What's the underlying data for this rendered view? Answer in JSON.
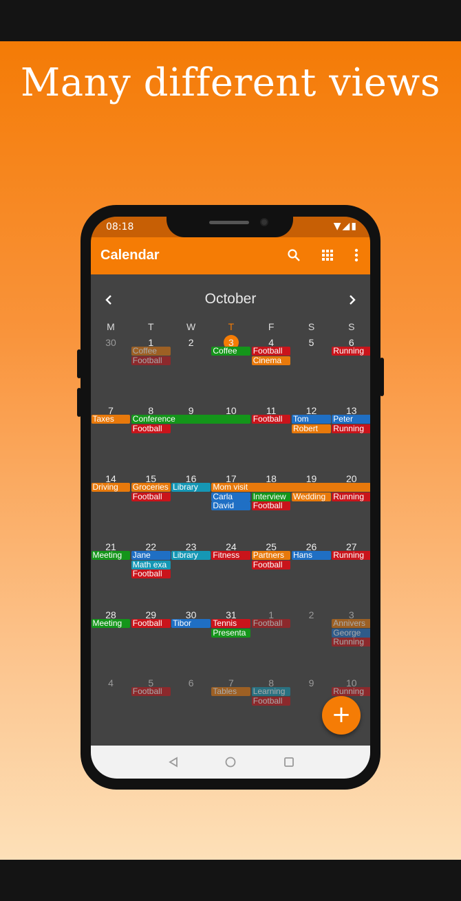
{
  "headline": "Many different views",
  "status": {
    "time": "08:18",
    "icons": [
      "wifi-icon",
      "signal-icon",
      "battery-icon"
    ]
  },
  "toolbar": {
    "title": "Calendar",
    "icons": [
      "search-icon",
      "grid-icon",
      "more-vert-icon"
    ]
  },
  "month": "October",
  "weekdays": [
    "M",
    "T",
    "W",
    "T",
    "F",
    "S",
    "S"
  ],
  "today_col": 3,
  "colors": {
    "accent": "#f57c05",
    "orange": "#e8790b",
    "red": "#c9141b",
    "green": "#14951a",
    "blue": "#1f6fc4",
    "teal": "#1597b5",
    "brown": "#b7671c"
  },
  "weeks": [
    {
      "days": [
        {
          "n": "30",
          "dim": true
        },
        {
          "n": "1"
        },
        {
          "n": "2"
        },
        {
          "n": "3",
          "today": true
        },
        {
          "n": "4"
        },
        {
          "n": "5"
        },
        {
          "n": "6"
        }
      ],
      "events": [
        {
          "t": "Coffee",
          "c": 1,
          "s": 1,
          "r": 0,
          "col": "orange",
          "faded": true
        },
        {
          "t": "Football",
          "c": 1,
          "s": 1,
          "r": 1,
          "col": "red",
          "faded": true
        },
        {
          "t": "Coffee",
          "c": 3,
          "s": 1,
          "r": 0,
          "col": "green"
        },
        {
          "t": "Football",
          "c": 4,
          "s": 1,
          "r": 0,
          "col": "red"
        },
        {
          "t": "Cinema",
          "c": 4,
          "s": 1,
          "r": 1,
          "col": "orange"
        },
        {
          "t": "Running",
          "c": 6,
          "s": 1,
          "r": 0,
          "col": "red"
        }
      ]
    },
    {
      "days": [
        {
          "n": "7"
        },
        {
          "n": "8"
        },
        {
          "n": "9"
        },
        {
          "n": "10"
        },
        {
          "n": "11"
        },
        {
          "n": "12"
        },
        {
          "n": "13"
        }
      ],
      "events": [
        {
          "t": "Taxes",
          "c": 0,
          "s": 1,
          "r": 0,
          "col": "orange"
        },
        {
          "t": "Conference",
          "c": 1,
          "s": 3,
          "r": 0,
          "col": "green"
        },
        {
          "t": "Football",
          "c": 1,
          "s": 1,
          "r": 1,
          "col": "red"
        },
        {
          "t": "Football",
          "c": 4,
          "s": 1,
          "r": 0,
          "col": "red"
        },
        {
          "t": "Tom",
          "c": 5,
          "s": 1,
          "r": 0,
          "col": "blue"
        },
        {
          "t": "Robert",
          "c": 5,
          "s": 1,
          "r": 1,
          "col": "orange"
        },
        {
          "t": "Peter",
          "c": 6,
          "s": 1,
          "r": 0,
          "col": "blue"
        },
        {
          "t": "Running",
          "c": 6,
          "s": 1,
          "r": 1,
          "col": "red"
        }
      ]
    },
    {
      "days": [
        {
          "n": "14"
        },
        {
          "n": "15"
        },
        {
          "n": "16"
        },
        {
          "n": "17"
        },
        {
          "n": "18"
        },
        {
          "n": "19"
        },
        {
          "n": "20"
        }
      ],
      "events": [
        {
          "t": "Driving",
          "c": 0,
          "s": 1,
          "r": 0,
          "col": "orange"
        },
        {
          "t": "Groceries",
          "c": 1,
          "s": 1,
          "r": 0,
          "col": "orange"
        },
        {
          "t": "Football",
          "c": 1,
          "s": 1,
          "r": 1,
          "col": "red"
        },
        {
          "t": "Library",
          "c": 2,
          "s": 1,
          "r": 0,
          "col": "teal"
        },
        {
          "t": "Mom visit",
          "c": 3,
          "s": 4,
          "r": 0,
          "col": "orange"
        },
        {
          "t": "Carla",
          "c": 3,
          "s": 1,
          "r": 1,
          "col": "blue"
        },
        {
          "t": "David",
          "c": 3,
          "s": 1,
          "r": 2,
          "col": "blue"
        },
        {
          "t": "Interview",
          "c": 4,
          "s": 1,
          "r": 1,
          "col": "green"
        },
        {
          "t": "Football",
          "c": 4,
          "s": 1,
          "r": 2,
          "col": "red"
        },
        {
          "t": "Wedding",
          "c": 5,
          "s": 1,
          "r": 1,
          "col": "orange"
        },
        {
          "t": "Running",
          "c": 6,
          "s": 1,
          "r": 1,
          "col": "red"
        }
      ]
    },
    {
      "days": [
        {
          "n": "21"
        },
        {
          "n": "22"
        },
        {
          "n": "23"
        },
        {
          "n": "24"
        },
        {
          "n": "25"
        },
        {
          "n": "26"
        },
        {
          "n": "27"
        }
      ],
      "events": [
        {
          "t": "Meeting",
          "c": 0,
          "s": 1,
          "r": 0,
          "col": "green"
        },
        {
          "t": "Jane",
          "c": 1,
          "s": 1,
          "r": 0,
          "col": "blue"
        },
        {
          "t": "Math exa",
          "c": 1,
          "s": 1,
          "r": 1,
          "col": "teal"
        },
        {
          "t": "Football",
          "c": 1,
          "s": 1,
          "r": 2,
          "col": "red"
        },
        {
          "t": "Library",
          "c": 2,
          "s": 1,
          "r": 0,
          "col": "teal"
        },
        {
          "t": "Fitness",
          "c": 3,
          "s": 1,
          "r": 0,
          "col": "red"
        },
        {
          "t": "Partners",
          "c": 4,
          "s": 1,
          "r": 0,
          "col": "orange"
        },
        {
          "t": "Football",
          "c": 4,
          "s": 1,
          "r": 1,
          "col": "red"
        },
        {
          "t": "Hans",
          "c": 5,
          "s": 1,
          "r": 0,
          "col": "blue"
        },
        {
          "t": "Running",
          "c": 6,
          "s": 1,
          "r": 0,
          "col": "red"
        }
      ]
    },
    {
      "days": [
        {
          "n": "28"
        },
        {
          "n": "29"
        },
        {
          "n": "30"
        },
        {
          "n": "31"
        },
        {
          "n": "1",
          "dim": true
        },
        {
          "n": "2",
          "dim": true
        },
        {
          "n": "3",
          "dim": true
        }
      ],
      "events": [
        {
          "t": "Meeting",
          "c": 0,
          "s": 1,
          "r": 0,
          "col": "green"
        },
        {
          "t": "Football",
          "c": 1,
          "s": 1,
          "r": 0,
          "col": "red"
        },
        {
          "t": "Tibor",
          "c": 2,
          "s": 1,
          "r": 0,
          "col": "blue"
        },
        {
          "t": "Tennis",
          "c": 3,
          "s": 1,
          "r": 0,
          "col": "red"
        },
        {
          "t": "Presenta",
          "c": 3,
          "s": 1,
          "r": 1,
          "col": "green"
        },
        {
          "t": "Football",
          "c": 4,
          "s": 1,
          "r": 0,
          "col": "red",
          "faded": true
        },
        {
          "t": "Annivers",
          "c": 6,
          "s": 1,
          "r": 0,
          "col": "orange",
          "faded": true
        },
        {
          "t": "George",
          "c": 6,
          "s": 1,
          "r": 1,
          "col": "blue",
          "faded": true
        },
        {
          "t": "Running",
          "c": 6,
          "s": 1,
          "r": 2,
          "col": "red",
          "faded": true
        }
      ]
    },
    {
      "days": [
        {
          "n": "4",
          "dim": true
        },
        {
          "n": "5",
          "dim": true
        },
        {
          "n": "6",
          "dim": true
        },
        {
          "n": "7",
          "dim": true
        },
        {
          "n": "8",
          "dim": true
        },
        {
          "n": "9",
          "dim": true
        },
        {
          "n": "10",
          "dim": true
        }
      ],
      "events": [
        {
          "t": "Football",
          "c": 1,
          "s": 1,
          "r": 0,
          "col": "red",
          "faded": true
        },
        {
          "t": "Tables",
          "c": 3,
          "s": 1,
          "r": 0,
          "col": "orange",
          "faded": true
        },
        {
          "t": "Learning",
          "c": 4,
          "s": 1,
          "r": 0,
          "col": "teal",
          "faded": true
        },
        {
          "t": "Football",
          "c": 4,
          "s": 1,
          "r": 1,
          "col": "red",
          "faded": true
        },
        {
          "t": "Running",
          "c": 6,
          "s": 1,
          "r": 0,
          "col": "red",
          "faded": true
        }
      ]
    }
  ],
  "fab_label": "+"
}
